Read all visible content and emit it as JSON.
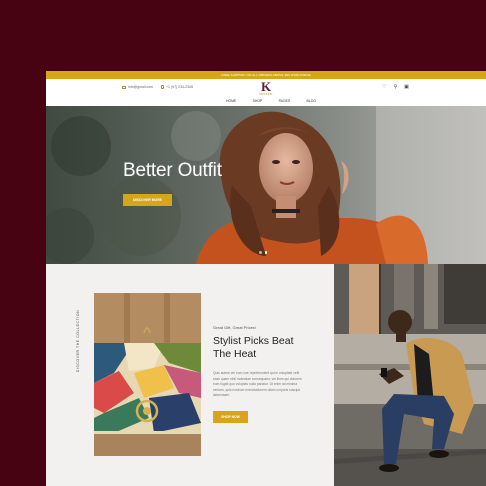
{
  "topbar": {
    "text": "FREE SHIPPING ON ALL ORDERS ABOVE $99 WORLDWIDE"
  },
  "header": {
    "email": "info@gmail.com",
    "phone": "+1 (97) 234-2345",
    "logo_mark": "K",
    "logo_text": "KROSSBI",
    "nav": [
      "Home",
      "Shop",
      "Pages",
      "Blog"
    ],
    "icons": [
      "heart-icon",
      "search-icon",
      "cart-icon"
    ]
  },
  "hero": {
    "title": "Better Outfit",
    "button": "DISCOVER MORE",
    "slides": 2,
    "active_slide": 2
  },
  "collection": {
    "vertical_label": "DISCOVER THE COLLECTION",
    "eyebrow": "Great Gift, Great Prices!",
    "heading_line1": "Stylist Picks Beat",
    "heading_line2": "The Heat",
    "paragraph": "Quis autem vel eum iure reprehenderit qui in voluptate velit esse quam nihil molestiae consequatur, vel illum qui dolorem eum fugiat quo voluptas nulla pariatur. Ut enim ad minima veniam, quis nostrum exercitationem ullam corporis suscipit laboriosam.",
    "button": "SHOP NOW"
  },
  "colors": {
    "brand_gold": "#d8a51a",
    "backdrop": "#480313",
    "logo": "#6a1a2c"
  }
}
